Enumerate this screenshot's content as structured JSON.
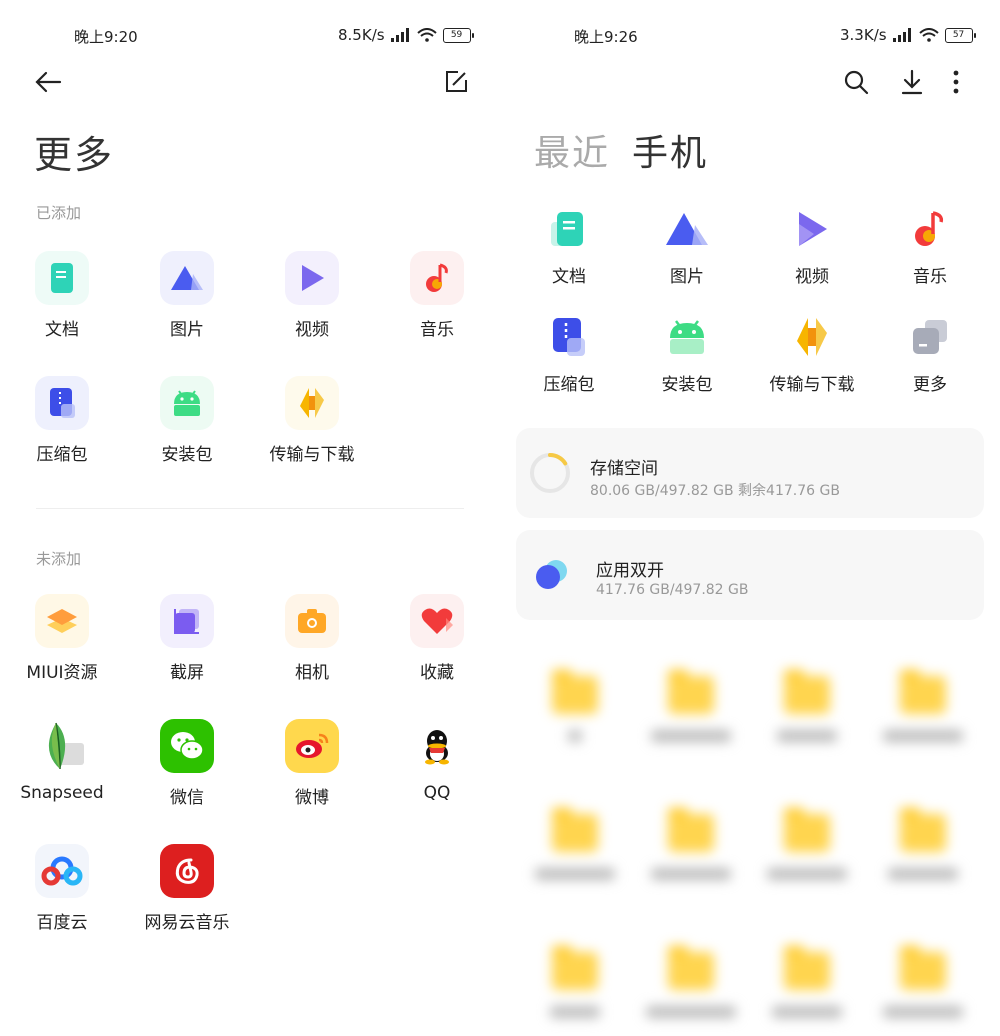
{
  "left": {
    "status": {
      "time": "晚上9:20",
      "speed": "8.5K/s",
      "battery": "59"
    },
    "title": "更多",
    "added_label": "已添加",
    "not_added_label": "未添加",
    "added": [
      {
        "label": "文档",
        "icon": "document-icon"
      },
      {
        "label": "图片",
        "icon": "image-icon"
      },
      {
        "label": "视频",
        "icon": "video-icon"
      },
      {
        "label": "音乐",
        "icon": "music-icon"
      },
      {
        "label": "压缩包",
        "icon": "archive-icon"
      },
      {
        "label": "安装包",
        "icon": "apk-icon"
      },
      {
        "label": "传输与下载",
        "icon": "transfer-icon"
      }
    ],
    "not_added": [
      {
        "label": "MIUI资源",
        "icon": "miui-resources-icon"
      },
      {
        "label": "截屏",
        "icon": "screenshot-icon"
      },
      {
        "label": "相机",
        "icon": "camera-icon"
      },
      {
        "label": "收藏",
        "icon": "favorites-icon"
      },
      {
        "label": "Snapseed",
        "icon": "snapseed-icon"
      },
      {
        "label": "微信",
        "icon": "wechat-icon"
      },
      {
        "label": "微博",
        "icon": "weibo-icon"
      },
      {
        "label": "QQ",
        "icon": "qq-icon"
      },
      {
        "label": "百度云",
        "icon": "baidu-cloud-icon"
      },
      {
        "label": "网易云音乐",
        "icon": "netease-music-icon"
      }
    ]
  },
  "right": {
    "status": {
      "time": "晚上9:26",
      "speed": "3.3K/s",
      "battery": "57"
    },
    "tabs": {
      "recent": "最近",
      "phone": "手机"
    },
    "categories": [
      {
        "label": "文档",
        "icon": "document-icon"
      },
      {
        "label": "图片",
        "icon": "image-icon"
      },
      {
        "label": "视频",
        "icon": "video-icon"
      },
      {
        "label": "音乐",
        "icon": "music-icon"
      },
      {
        "label": "压缩包",
        "icon": "archive-icon"
      },
      {
        "label": "安装包",
        "icon": "apk-icon"
      },
      {
        "label": "传输与下载",
        "icon": "transfer-icon"
      },
      {
        "label": "更多",
        "icon": "more-icon"
      }
    ],
    "storage": {
      "title": "存储空间",
      "detail": "80.06 GB/497.82 GB  剩余417.76 GB",
      "used_fraction": 0.16
    },
    "dual_apps": {
      "title": "应用双开",
      "detail": "417.76 GB/497.82 GB"
    }
  },
  "colors": {
    "doc": "#2ed3b7",
    "image": "#4a5cf0",
    "video": "#7b68ee",
    "music": "#f23b3b",
    "archive": "#3d4ee8",
    "apk": "#3ddc84",
    "transfer": "#f7b500",
    "storage_ring": "#f6c945"
  }
}
